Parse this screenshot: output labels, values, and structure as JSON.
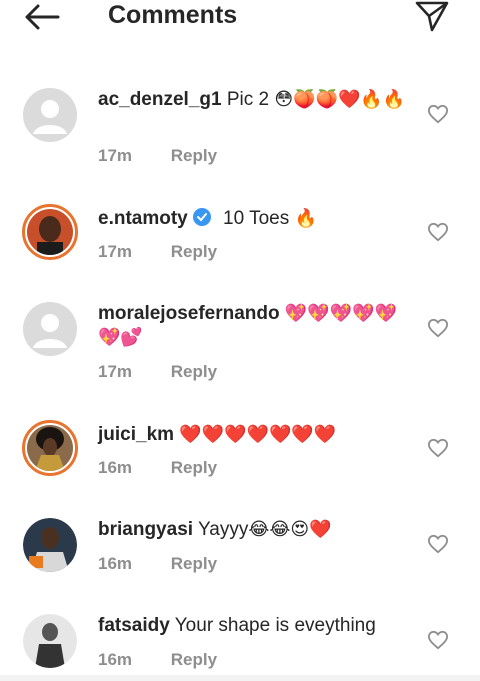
{
  "header": {
    "title": "Comments"
  },
  "comments": [
    {
      "username": "ac_denzel_g1",
      "text": "Pic 2",
      "emoji": "😳🍑🍑❤️🔥🔥",
      "time": "17m",
      "reply": "Reply",
      "avatar": "default-avatar"
    },
    {
      "username": "e.ntamoty",
      "text": "10 Toes",
      "emoji": "🔥",
      "time": "17m",
      "reply": "Reply",
      "avatar": "photo-avatar",
      "verified": true
    },
    {
      "username": "moralejosefernando",
      "text": "",
      "emoji": "💖💖💖💖💖💖💕",
      "time": "17m",
      "reply": "Reply",
      "avatar": "default-avatar"
    },
    {
      "username": "juici_km",
      "text": "",
      "emoji": "❤️❤️❤️❤️❤️❤️❤️",
      "time": "16m",
      "reply": "Reply",
      "avatar": "photo-avatar"
    },
    {
      "username": "briangyasi",
      "text": "Yayyy",
      "emoji": "😂😂😍❤️",
      "time": "16m",
      "reply": "Reply",
      "avatar": "photo-avatar"
    },
    {
      "username": "fatsaidy",
      "text": "Your shape is eveything",
      "emoji": "",
      "time": "16m",
      "reply": "Reply",
      "avatar": "photo-avatar"
    }
  ],
  "colors": {
    "story_ring": "#e8742f",
    "verified": "#3897f0",
    "muted_text": "#8e8e8e",
    "heart_red": "#e0202a"
  }
}
